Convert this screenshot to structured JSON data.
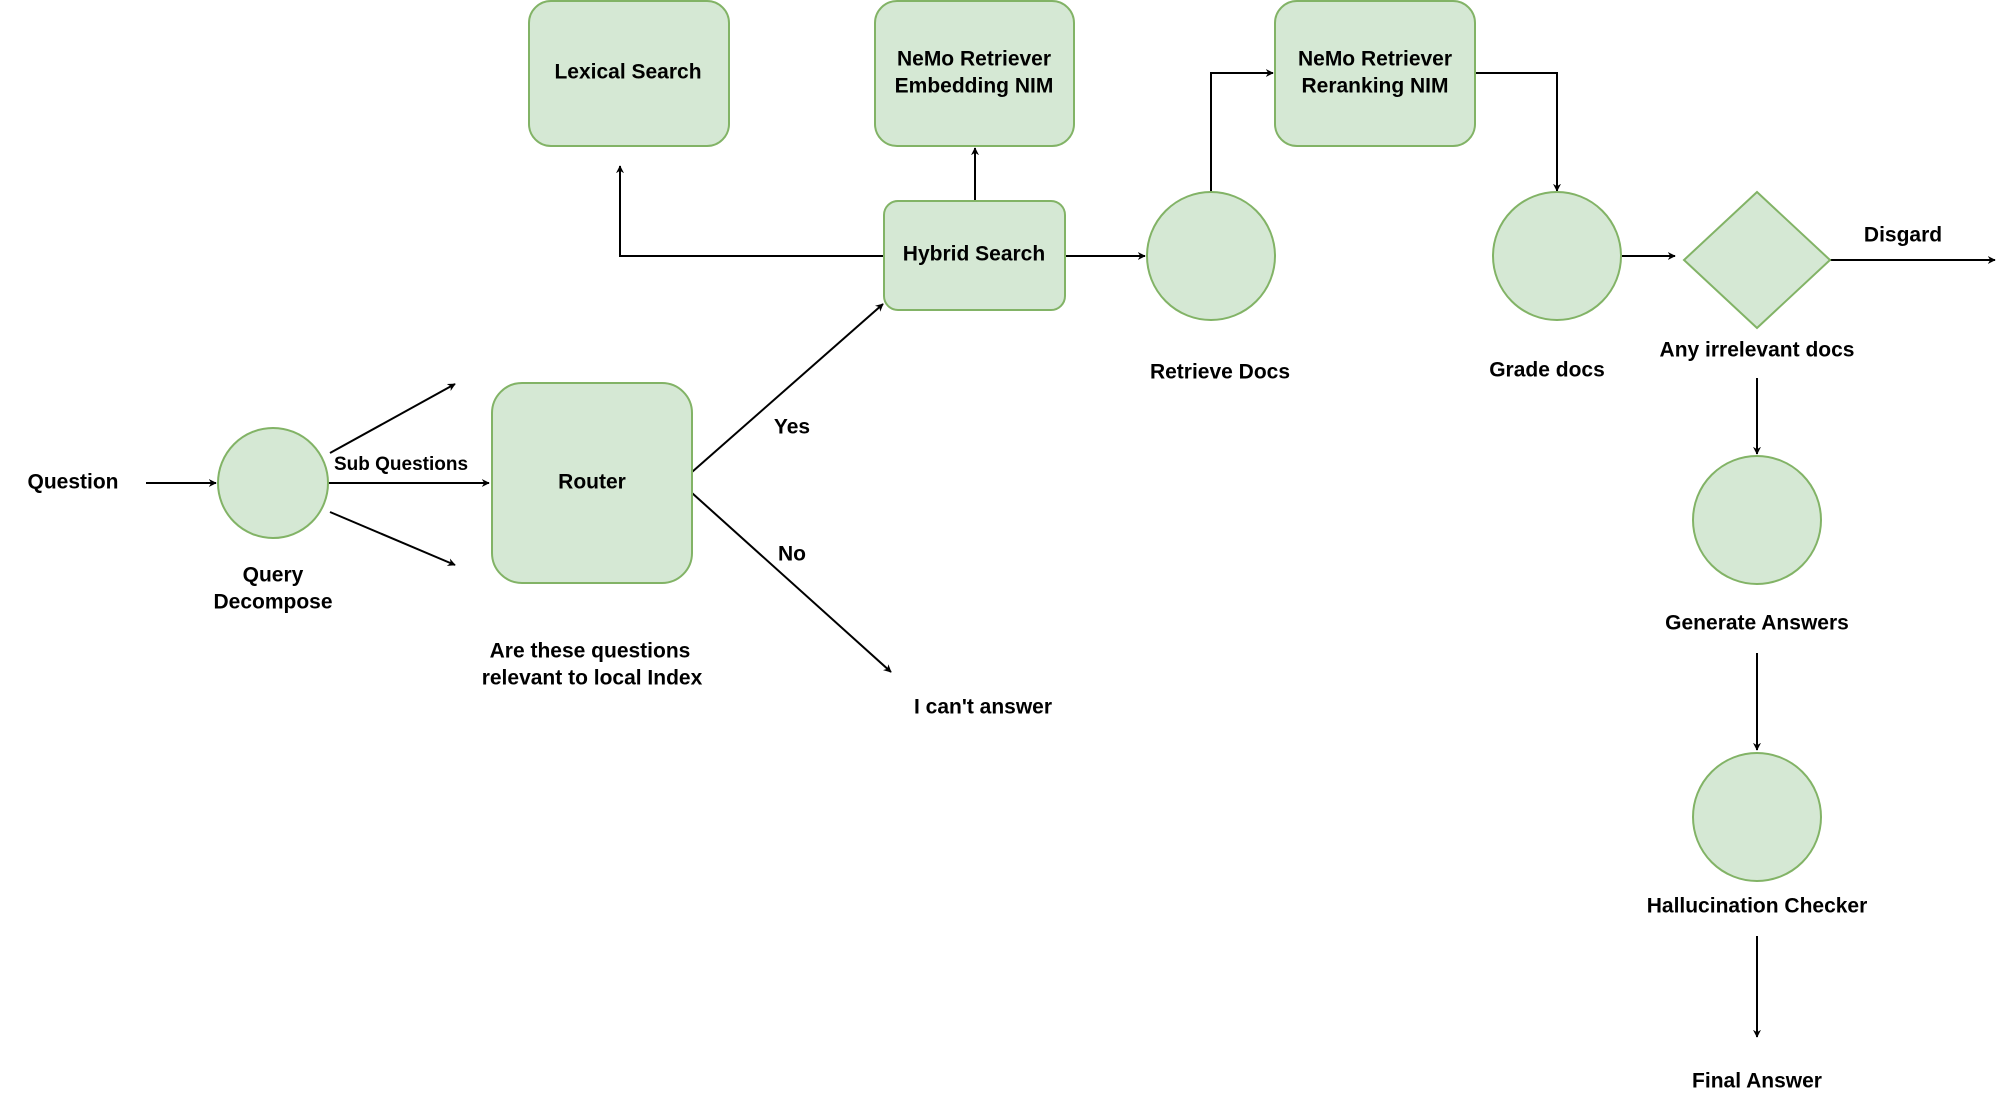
{
  "diagram": {
    "colors": {
      "node_fill": "#d5e8d4",
      "node_stroke": "#82b366",
      "edge": "#000000"
    },
    "input": {
      "label": "Question"
    },
    "query_decompose": {
      "label_line1": "Query",
      "label_line2": "Decompose",
      "edge_label": "Sub Questions"
    },
    "router": {
      "label": "Router",
      "caption_line1": "Are these questions",
      "caption_line2": "relevant to local Index",
      "yes_label": "Yes",
      "no_label": "No",
      "no_target": "I can't answer"
    },
    "lexical_search": {
      "label": "Lexical Search"
    },
    "embedding": {
      "label_line1": "NeMo Retriever",
      "label_line2": "Embedding NIM"
    },
    "hybrid_search": {
      "label": "Hybrid Search"
    },
    "retrieve_docs": {
      "label": "Retrieve Docs"
    },
    "reranking": {
      "label_line1": "NeMo Retriever",
      "label_line2": "Reranking NIM"
    },
    "grade_docs": {
      "label": "Grade docs"
    },
    "decision": {
      "label": "Any irrelevant docs",
      "discard_label": "Disgard"
    },
    "generate": {
      "label": "Generate Answers"
    },
    "hallucination": {
      "label": "Hallucination Checker"
    },
    "output": {
      "label": "Final Answer"
    }
  }
}
